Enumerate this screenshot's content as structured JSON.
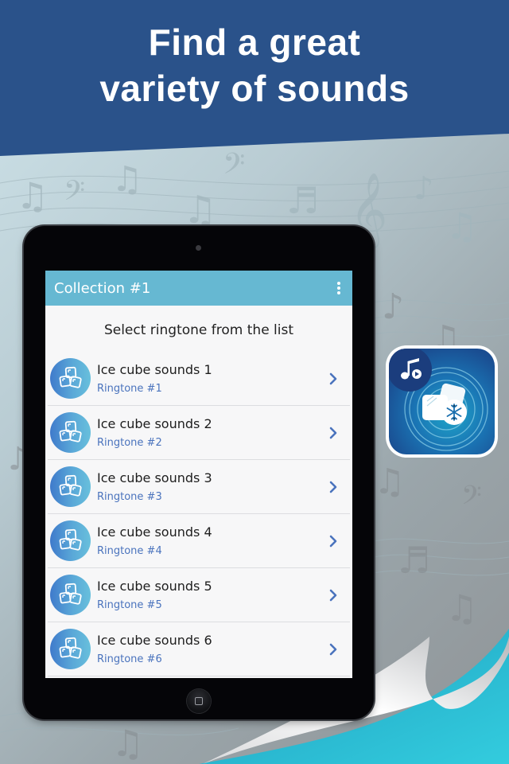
{
  "headline": {
    "line1": "Find a great",
    "line2": "variety of sounds"
  },
  "colors": {
    "header_band": "#2a528a",
    "appbar": "#66b8d2",
    "subtitle_text": "#4a73bd",
    "chevron": "#4a73bd",
    "page_curl_accent": "#2ec5d9"
  },
  "app": {
    "title": "Collection #1",
    "menu_icon": "kebab-menu-icon",
    "subheading": "Select ringtone from the list",
    "items": [
      {
        "title": "Ice cube sounds 1",
        "subtitle": "Ringtone #1",
        "icon": "ice-cubes-icon"
      },
      {
        "title": "Ice cube sounds 2",
        "subtitle": "Ringtone #2",
        "icon": "ice-cubes-icon"
      },
      {
        "title": "Ice cube sounds 3",
        "subtitle": "Ringtone #3",
        "icon": "ice-cubes-icon"
      },
      {
        "title": "Ice cube sounds 4",
        "subtitle": "Ringtone #4",
        "icon": "ice-cubes-icon"
      },
      {
        "title": "Ice cube sounds 5",
        "subtitle": "Ringtone #5",
        "icon": "ice-cubes-icon"
      },
      {
        "title": "Ice cube sounds 6",
        "subtitle": "Ringtone #6",
        "icon": "ice-cubes-icon"
      }
    ]
  },
  "promo_icon": {
    "name": "app-logo-icon",
    "elements": [
      "music-note-play-icon",
      "ice-cubes-icon",
      "snowflake-icon"
    ]
  }
}
